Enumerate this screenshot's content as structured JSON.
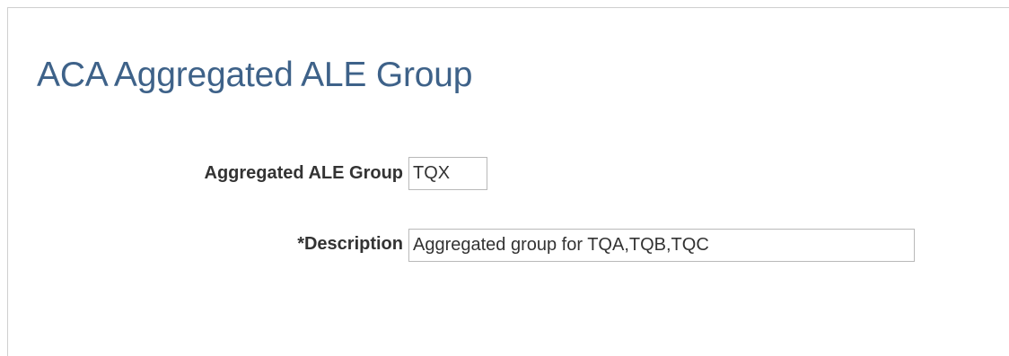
{
  "page": {
    "title": "ACA Aggregated ALE Group"
  },
  "form": {
    "aggregated_ale_group": {
      "label": "Aggregated ALE Group",
      "value": "TQX"
    },
    "description": {
      "label": "*Description",
      "value": "Aggregated group for TQA,TQB,TQC"
    }
  }
}
